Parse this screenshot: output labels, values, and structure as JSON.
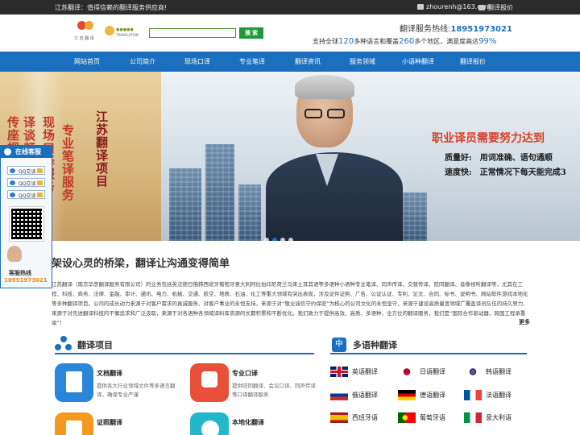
{
  "topbar": {
    "slogan": "江苏翻译：值得信赖的翻译服务供应商!",
    "email": "zhourenh@163.com",
    "quote_link": "翻译报价"
  },
  "header": {
    "logo1_text": "江 苏 翻 译",
    "logo2_text": "TRANSLATION",
    "search": {
      "value": "",
      "button": "搜 索"
    },
    "hotline_label": "翻译服务热线:",
    "hotline_number": "18951973021",
    "support": {
      "p1": "支持全球",
      "n1": "120",
      "p2": "多种语言和覆盖",
      "n2": "260",
      "p3": "多个地区，满意度高达",
      "n3": "99%"
    }
  },
  "nav": {
    "items": [
      "网站首页",
      "公司简介",
      "现场口译",
      "专业笔译",
      "翻译资讯",
      "服务领域",
      "小语种翻译",
      "翻译报价"
    ]
  },
  "banner": {
    "headline": "职业译员需要努力达到",
    "line1": "质量好:　用词准确、语句通顺",
    "line2": "速度快:　正常情况下每天能完成3",
    "vcol1": "传座视",
    "vcol2": "译谈频",
    "vcol3": "现场口译服务",
    "vcol4": "专业笔译服务",
    "vcol5": "江苏翻译项目",
    "active_slide": 1,
    "slide_count": 4
  },
  "customer_service": {
    "title": "在线客服",
    "qq_items": [
      "QQ交谈",
      "QQ交谈",
      "QQ交谈"
    ],
    "hotline_label": "客服热线",
    "phone": "18951973021"
  },
  "intro": {
    "title": "架设心灵的桥梁，翻译让沟通变得简单",
    "text": "江苏翻译（南京华彦翻译服务有限公司）的业务包括英法德日俄韩西班牙葡萄牙意大利阿拉伯印尼荷兰马来土耳其语等多语种小语种专业笔译、同声传译、交替传译、陪同翻译、音像视听翻译等，尤其在工程、科技、商务、法律、金融、审计、通讯、电力、机械、交通、航空、地质、石油、化工等重大领域有突出表现，涉及证件证照、广告、公证认证、专利、论文、合同、标书、说明书、网站软件游戏本地化等多种翻译项目。公司的成长动力来源于对客户需求的真诚服务、对客户事业的永恒支持，来源于对“敬业诚信守约保密”为核心的公司文化的永恒坚守，来源于建设高质量宽领域广覆盖译员队伍的持久努力、来源于对先进翻译科技的不懈追求和广泛汲取，来源于对各语种各领域译料库资源的长期积累和不断优化。我们致力于提供高效、高质、多语种、全方位的翻译服务，我们是“国际合作驱动器，跨国工程承重梁”！",
    "more": "更多"
  },
  "projects": {
    "title": "翻译项目",
    "items": [
      {
        "title": "文档翻译",
        "desc": "提供各大行业领域文件等多语言翻译，确保专业严谨",
        "color": "#2a86d8"
      },
      {
        "title": "专业口译",
        "desc": "提供陪同翻译、会议口译、同声传译等口译翻译服务",
        "color": "#e8503a"
      },
      {
        "title": "证照翻译",
        "desc": "",
        "color": "#f39a1e"
      },
      {
        "title": "本地化翻译",
        "desc": "",
        "color": "#22b8c9"
      }
    ]
  },
  "languages": {
    "title": "多语种翻译",
    "zh_icon": "中",
    "items": [
      "英语翻译",
      "日语翻译",
      "韩语翻译",
      "俄语翻译",
      "德语翻译",
      "法语翻译",
      "西班牙语",
      "葡萄牙语",
      "意大利语"
    ]
  }
}
